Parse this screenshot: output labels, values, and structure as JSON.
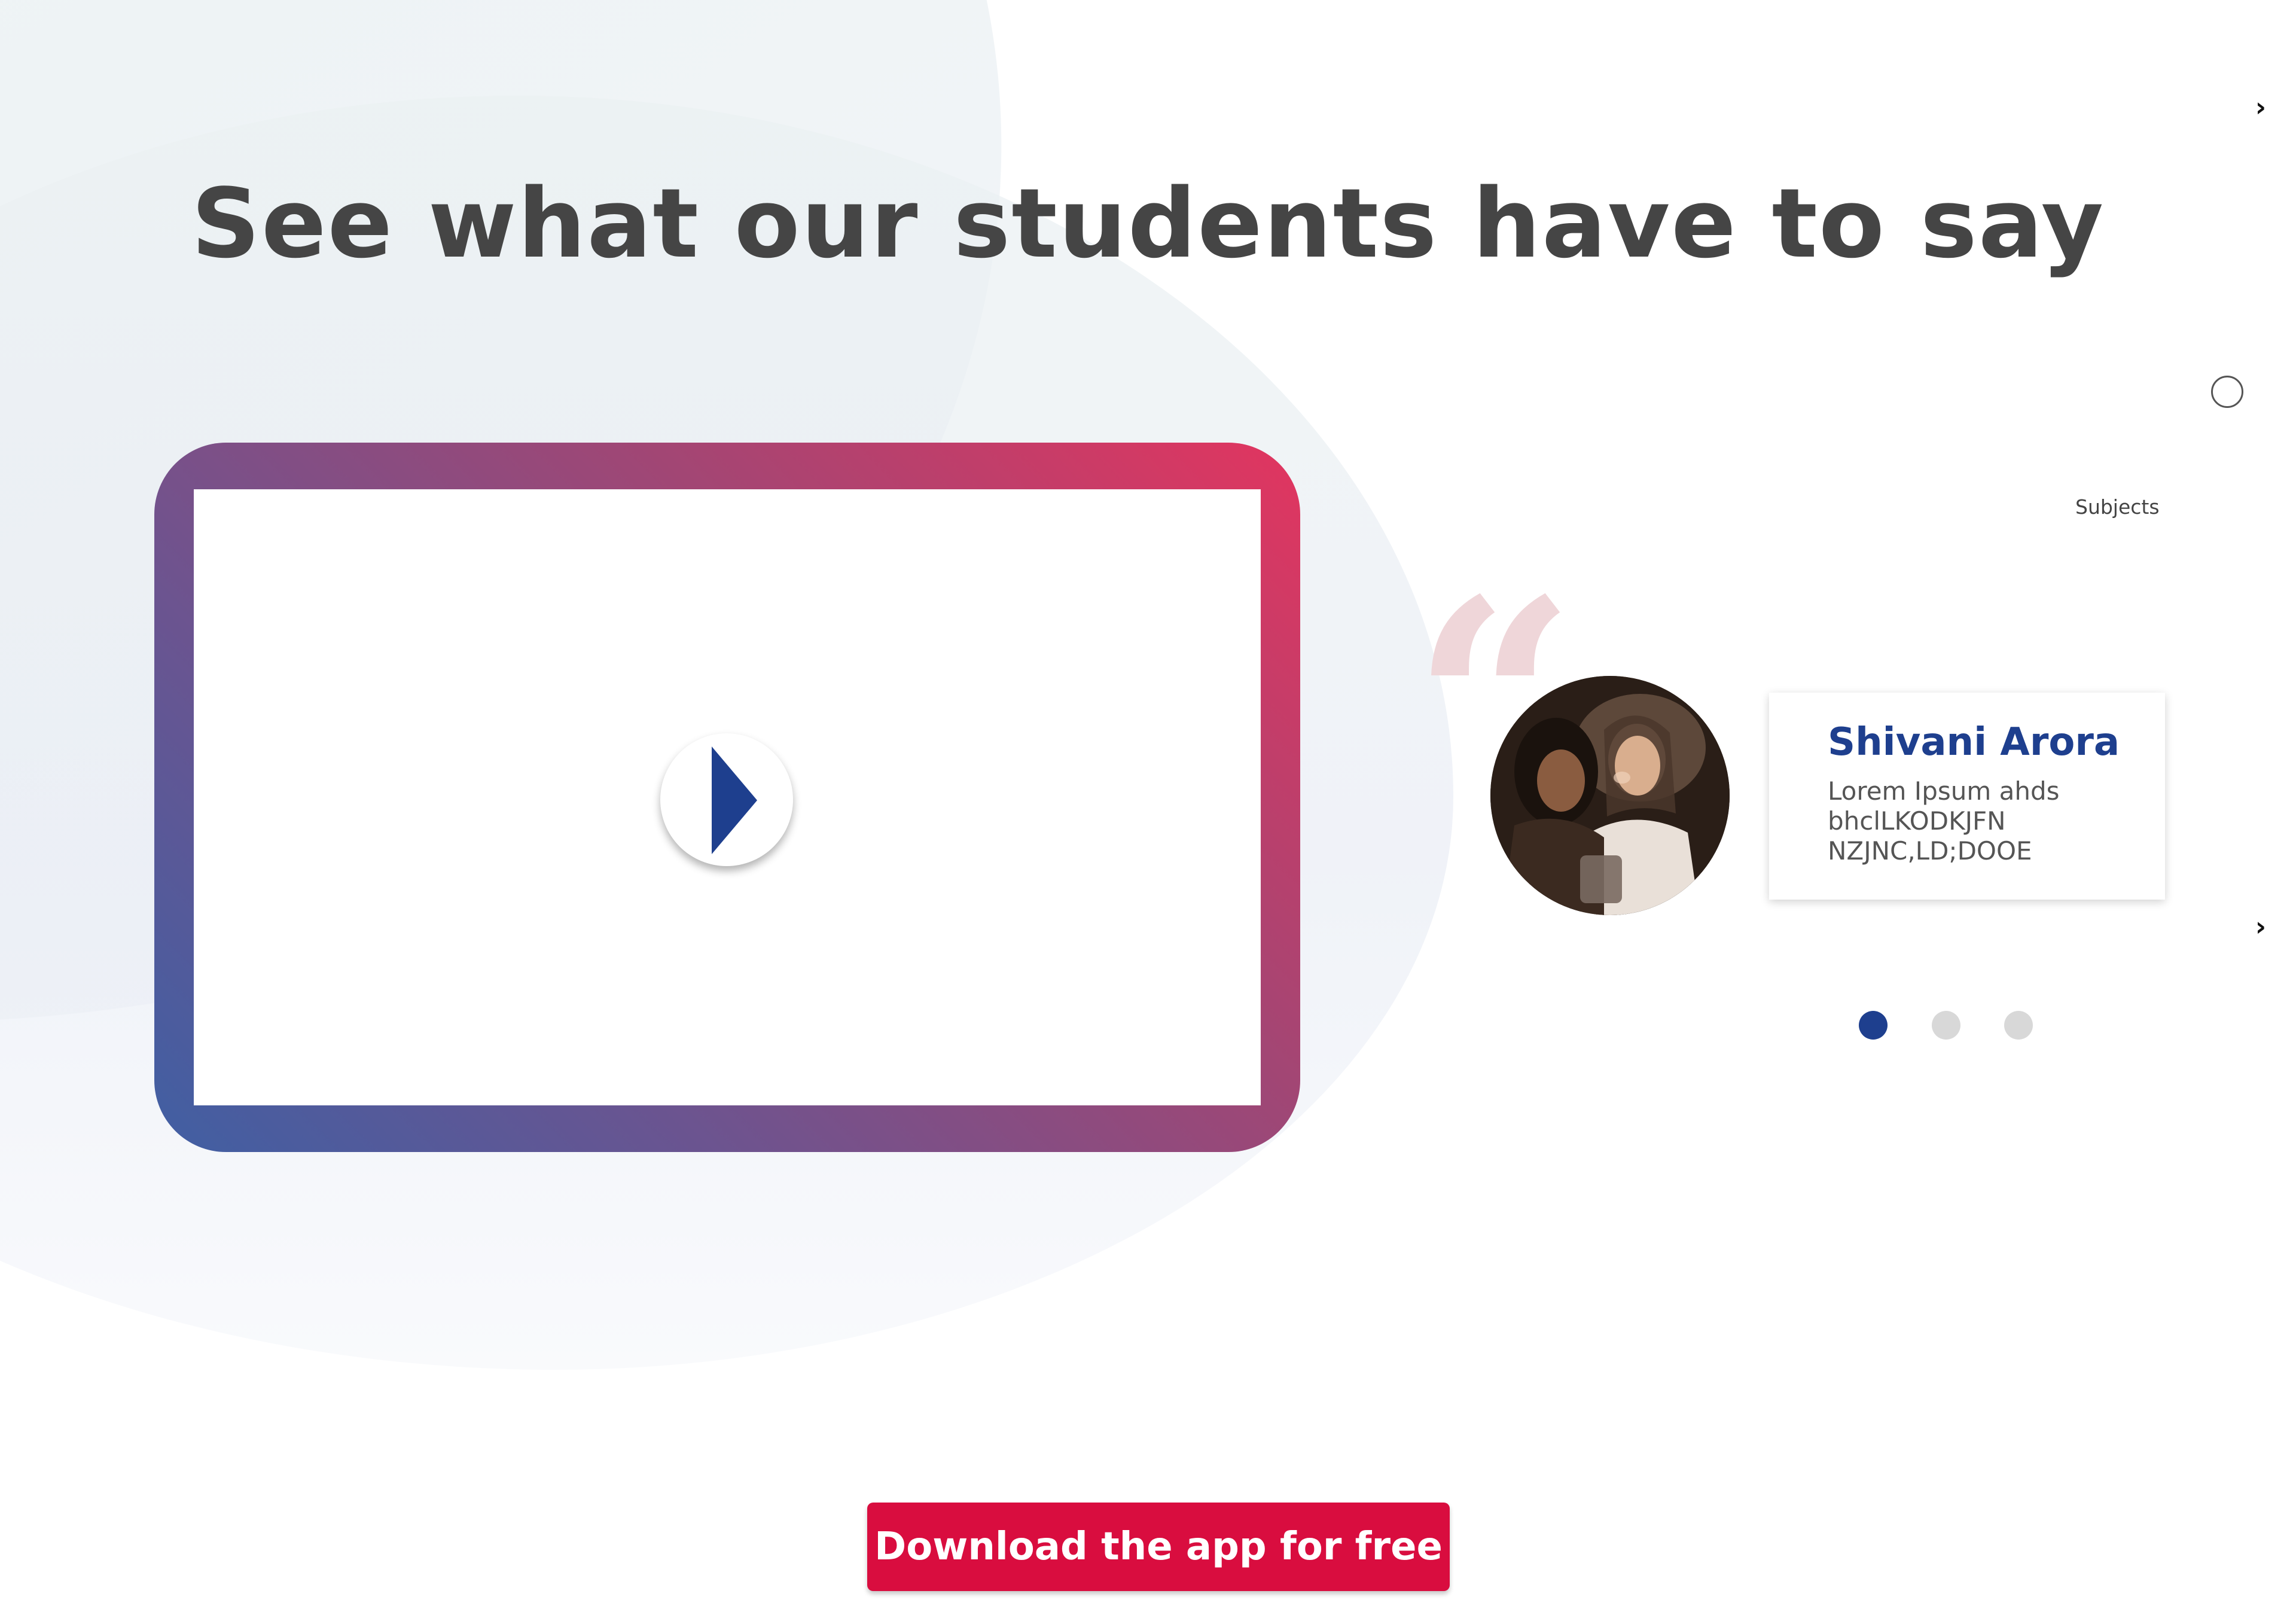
{
  "section": {
    "heading": "See what our students have to say"
  },
  "side_nav": {
    "subjects_label": "Subjects",
    "next_top_icon": "chevron-right-icon",
    "next_bottom_icon": "chevron-right-icon",
    "radio_icon": "circle-outline-icon"
  },
  "video": {
    "play_icon": "play-icon",
    "frame_gradient": [
      "#405fa3",
      "#e2355f"
    ]
  },
  "testimonial": {
    "quote_icon": "quote-open-icon",
    "name": "Shivani Arora",
    "text": "Lorem Ipsum ahds bhclLKODKJFN NZJNC,LD;DOOE"
  },
  "carousel": {
    "slide_count": 3,
    "active_index": 0
  },
  "cta": {
    "label": "Download the app for free"
  },
  "colors": {
    "brand_blue": "#1e3f8e",
    "cta_red": "#d90d3f",
    "heading_gray": "#454545",
    "quote_pink": "#efd6d9"
  }
}
